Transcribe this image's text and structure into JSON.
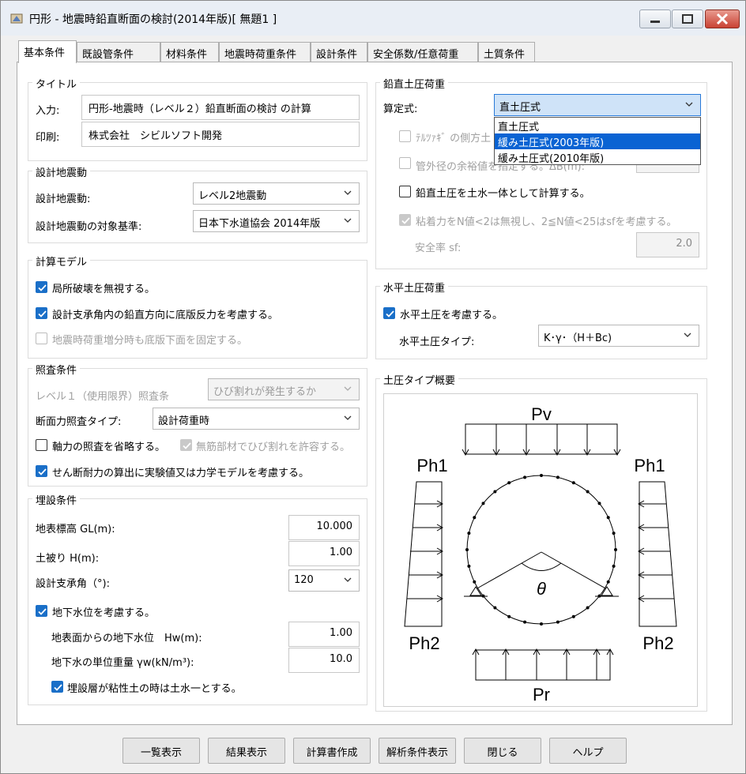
{
  "window": {
    "title": "円形 - 地震時鉛直断面の検討(2014年版)[ 無題1 ]"
  },
  "tabs": [
    "基本条件",
    "既設管条件",
    "材料条件",
    "地震時荷重条件",
    "設計条件",
    "安全係数/任意荷重",
    "土質条件"
  ],
  "title_group": {
    "label": "タイトル",
    "input_label": "入力:",
    "input_value": "円形-地震時（レベル２）鉛直断面の検討 の計算",
    "print_label": "印刷:",
    "print_value": "株式会社　シビルソフト開発"
  },
  "seismic_group": {
    "label": "設計地震動",
    "motion_label": "設計地震動:",
    "motion_value": "レベル2地震動",
    "standard_label": "設計地震動の対象基準:",
    "standard_value": "日本下水道協会 2014年版"
  },
  "model_group": {
    "label": "計算モデル",
    "opt1": "局所破壊を無視する。",
    "opt2": "設計支承角内の鉛直方向に底版反力を考慮する。",
    "opt3": "地震時荷重増分時も底版下面を固定する。"
  },
  "check_group": {
    "label": "照査条件",
    "level1_label": "レベル１（使用限界）照査条",
    "level1_value": "ひび割れが発生するか",
    "type_label": "断面力照査タイプ:",
    "type_value": "設計荷重時",
    "axial": "軸力の照査を省略する。",
    "unreinforced": "無筋部材でひび割れを許容する。",
    "shear": "せん断耐力の算出に実験値又は力学モデルを考慮する。"
  },
  "burial_group": {
    "label": "埋設条件",
    "gl_label": "地表標高 GL(m):",
    "gl_value": "10.000",
    "h_label": "土被り H(m):",
    "h_value": "1.00",
    "angle_label": "設計支承角（°):",
    "angle_value": "120",
    "groundwater": "地下水位を考慮する。",
    "hw_label": "地表面からの地下水位　Hw(m):",
    "hw_value": "1.00",
    "gamma_label": "地下水の単位重量 γw(kN/m³):",
    "gamma_value": "10.0",
    "clay": "埋設層が粘性土の時は土水一とする。"
  },
  "vertical_group": {
    "label": "鉛直土圧荷重",
    "formula_label": "算定式:",
    "formula_value": "直土圧式",
    "opt_terzaghi": "ﾃﾙﾂｧｷﾞ の側方土",
    "opt_margin": "管外径の余裕値を指定する。ΔB(m):",
    "opt_integrated": "鉛直土圧を土水一体として計算する。",
    "opt_cohesion": "粘着力をN値<2は無視し、2≦N値<25はsfを考慮する。",
    "sf_label": "安全率 sf:",
    "sf_value": "2.0",
    "dropdown_options": [
      "直土圧式",
      "緩み土圧式(2003年版)",
      "緩み土圧式(2010年版)"
    ]
  },
  "horizontal_group": {
    "label": "水平土圧荷重",
    "consider": "水平土圧を考慮する。",
    "type_label": "水平土圧タイプ:",
    "type_value": "K･γ･（H＋Bc)"
  },
  "overview_group": {
    "label": "土圧タイプ概要",
    "pv": "Pv",
    "ph1_left": "Ph1",
    "ph1_right": "Ph1",
    "ph2_left": "Ph2",
    "ph2_right": "Ph2",
    "pr": "Pr",
    "theta": "θ"
  },
  "buttons": {
    "list": "一覧表示",
    "result": "結果表示",
    "report": "計算書作成",
    "analysis": "解析条件表示",
    "close": "閉じる",
    "help": "ヘルプ"
  }
}
